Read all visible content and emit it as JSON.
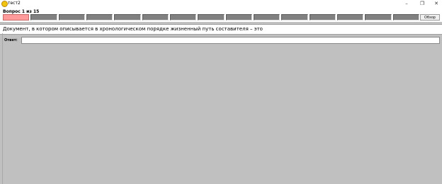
{
  "window": {
    "title": "тест2",
    "minimize_glyph": "–",
    "maximize_glyph": "❐",
    "close_glyph": "✕"
  },
  "toolbar": {
    "question_counter": "Вопрос 1 из 15",
    "browse_label": "Обзор",
    "progress": {
      "total": 15,
      "current": 1
    }
  },
  "question": {
    "text": "Документ, в котором описывается в хронологическом порядке жизненный путь составителя – это"
  },
  "answer": {
    "label": "Ответ:",
    "value": ""
  },
  "colors": {
    "background": "#c0c0c0",
    "segment": "#808080",
    "segment_current": "#ff9a9a"
  }
}
